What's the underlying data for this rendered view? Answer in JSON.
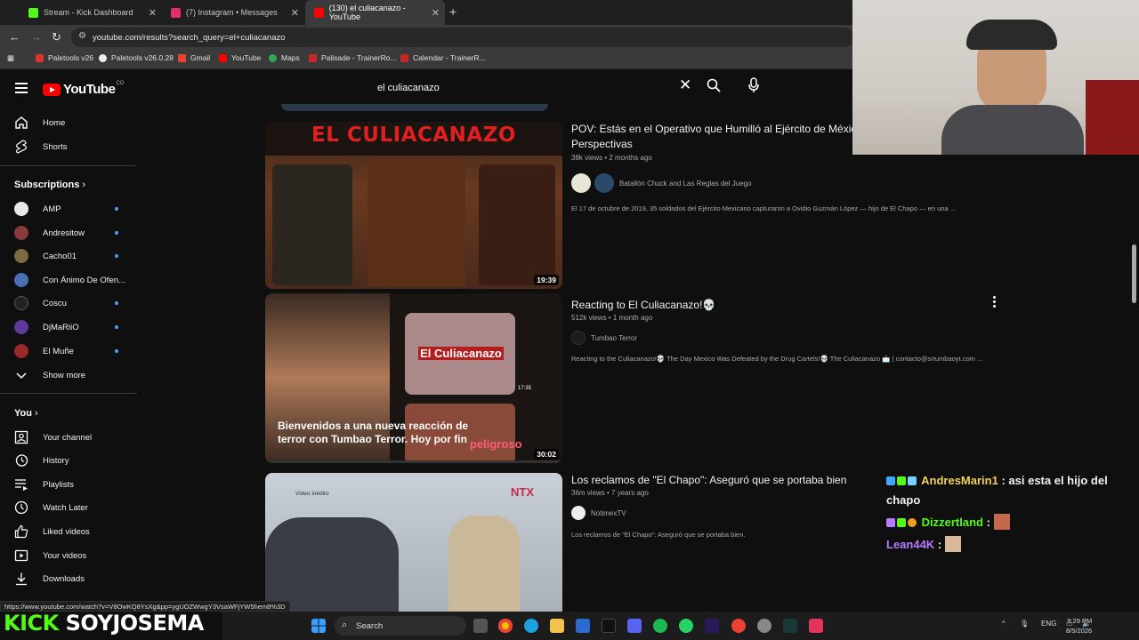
{
  "browser": {
    "tabs": [
      {
        "label": "Stream - Kick Dashboard",
        "icon": "kick-icon",
        "color": "#53fc18"
      },
      {
        "label": "(7) Instagram • Messages",
        "icon": "instagram-icon",
        "color": "#e1306c"
      },
      {
        "label": "(130) el culiacanazo - YouTube",
        "icon": "youtube-icon",
        "color": "#ff0000"
      }
    ],
    "url": "youtube.com/results?search_query=el+culiacanazo",
    "bookmarks": [
      {
        "label": "Paletools v26"
      },
      {
        "label": "Paletools v26.0.28"
      },
      {
        "label": "Gmail"
      },
      {
        "label": "YouTube"
      },
      {
        "label": "Maps"
      },
      {
        "label": "Palisade - TrainerRo..."
      },
      {
        "label": "Calendar - TrainerR..."
      }
    ]
  },
  "youtube": {
    "logo_text": "YouTube",
    "country_code": "CO",
    "search_query": "el culiacanazo"
  },
  "sidebar": {
    "main": [
      {
        "label": "Home",
        "icon": "home-icon"
      },
      {
        "label": "Shorts",
        "icon": "shorts-icon"
      }
    ],
    "subscriptions_title": "Subscriptions",
    "subscriptions": [
      {
        "label": "AMP",
        "color": "#e8e8e8"
      },
      {
        "label": "Andresitow",
        "color": "#8a3a3a"
      },
      {
        "label": "Cacho01",
        "color": "#7a6a40"
      },
      {
        "label": "Con Ánimo De Ofen...",
        "color": "#4a6fb5"
      },
      {
        "label": "Coscu",
        "color": "#222222"
      },
      {
        "label": "DjMaRiiO",
        "color": "#5b3a9a"
      },
      {
        "label": "El Muñe",
        "color": "#9a2a2a"
      }
    ],
    "show_more": "Show more",
    "you_title": "You",
    "you_items": [
      {
        "label": "Your channel",
        "icon": "channel-icon"
      },
      {
        "label": "History",
        "icon": "history-icon"
      },
      {
        "label": "Playlists",
        "icon": "playlists-icon"
      },
      {
        "label": "Watch Later",
        "icon": "watch-later-icon"
      },
      {
        "label": "Liked videos",
        "icon": "like-icon"
      },
      {
        "label": "Your videos",
        "icon": "your-videos-icon"
      },
      {
        "label": "Downloads",
        "icon": "download-icon"
      }
    ]
  },
  "results": [
    {
      "title_line1": "POV: Estás en el Operativo que Humilló al Ejército de México",
      "title_line2": "Perspectivas",
      "meta": "38k views • 2 months ago",
      "channel": "Batallón Chuck and Las Reglas del Juego",
      "description": "El 17 de octubre de 2019, 35 soldados del Ejército Mexicano capturaron a Ovidio Guzmán López — hijo de El Chapo — en una ...",
      "duration": "19:39",
      "thumb_title": "EL CULIACANAZO"
    },
    {
      "title_line1": "Reacting to El Culiacanazo!💀",
      "meta": "512k views • 1 month ago",
      "channel": "Tumbao Terror",
      "description": "Reacting to the Culiacanazo!💀 The Day Mexico Was Defeated by the Drug Cartels!💀 The Culiacanazo 📩 | contacto@srtumbaoyt.com ...",
      "duration": "30:02",
      "caption": "Bienvenidos a una nueva reacción de terror con Tumbao Terror. Hoy por fin",
      "thumb_inner": "El Culiacanazo",
      "thumb_inner2": "peligroso",
      "thumb_inner_dur": "17:35"
    },
    {
      "title_line1": "Los reclamos de \"El Chapo\": Aseguró que se portaba bien",
      "meta": "36m views • 7 years ago",
      "channel": "NotimexTV",
      "description": "Los reclamos de \"El Chapo\": Aseguró que se portaba bien.",
      "thumb_logo": "NTX",
      "thumb_tag": "Video inédito"
    }
  ],
  "status_url": "https://www.youtube.com/watch?v=V8OwKQ8YsXg&pp=ygUOZWwgY3VsaWFjYW5hem8%3D",
  "chat": [
    {
      "user": "AndresMarin1",
      "sep": " :",
      "message": " asi esta el hijo del chapo",
      "color": "#f0d35c"
    },
    {
      "user": "Dizzertland",
      "sep": " :",
      "message": "",
      "color": "#53fc18"
    },
    {
      "user": "Lean44K",
      "sep": " :",
      "message": "",
      "color": "#b67cff"
    }
  ],
  "stream_overlay": {
    "brand": "KICK",
    "channel": "SOYJOSEMA"
  },
  "taskbar": {
    "search_label": "Search",
    "language": "ENG",
    "time": "9:29 PM",
    "date": "8/5/2026"
  }
}
